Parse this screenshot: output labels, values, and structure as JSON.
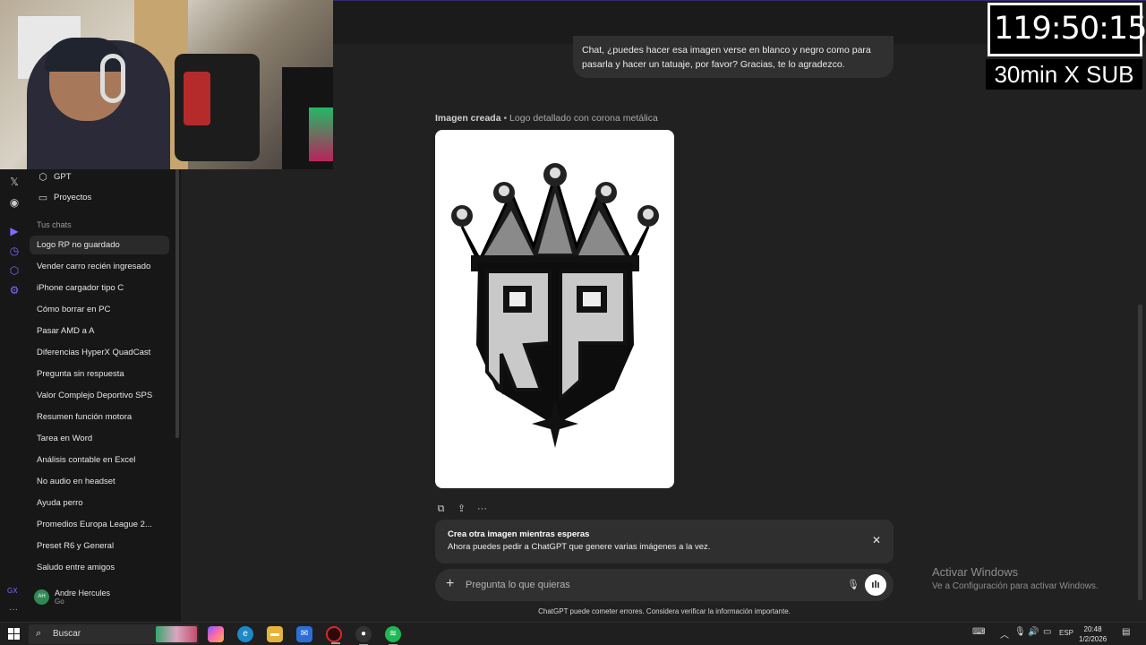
{
  "timer": {
    "time": "119:50:15",
    "subtitle": "30min X SUB"
  },
  "sidebar": {
    "top_items": [
      {
        "label": "GPT",
        "icon": "cube-icon"
      },
      {
        "label": "Proyectos",
        "icon": "folder-icon"
      }
    ],
    "section_title": "Tus chats",
    "chats": [
      "Logo RP no guardado",
      "Vender carro recién ingresado",
      "iPhone cargador tipo C",
      "Cómo borrar en PC",
      "Pasar AMD a A",
      "Diferencias HyperX QuadCast",
      "Pregunta sin respuesta",
      "Valor Complejo Deportivo SPS",
      "Resumen función motora",
      "Tarea en Word",
      "Análisis contable en Excel",
      "No audio en headset",
      "Ayuda perro",
      "Promedios Europa League 2...",
      "Preset R6 y General",
      "Saludo entre amigos"
    ],
    "user": {
      "initials": "AH",
      "name": "Andre Hercules",
      "plan": "Go"
    },
    "rail_label": "GX"
  },
  "chat": {
    "user_message": "Chat, ¿puedes hacer esa imagen verse en blanco y negro como para pasarla y hacer un tatuaje, por favor? Gracias, te lo agradezco.",
    "image_label_bold": "Imagen creada",
    "image_label_rest": " • Logo detallado con corona metálica",
    "image_logo_text": "RP",
    "notice_title": "Crea otra imagen mientras esperas",
    "notice_body": "Ahora puedes pedir a ChatGPT que genere varias imágenes a la vez.",
    "composer_placeholder": "Pregunta lo que quieras",
    "disclaimer": "ChatGPT puede cometer errores. Considera verificar la información importante."
  },
  "watermark": {
    "title": "Activar Windows",
    "subtitle": "Ve a Configuración para activar Windows."
  },
  "taskbar": {
    "search_placeholder": "Buscar",
    "language": "ESP",
    "time": "20:48",
    "date": "1/2/2026"
  },
  "colors": {
    "accent_purple": "#7e6bff",
    "avatar_green": "#2f8a52",
    "opera_red": "#d9262a",
    "spotify_green": "#1db954"
  }
}
